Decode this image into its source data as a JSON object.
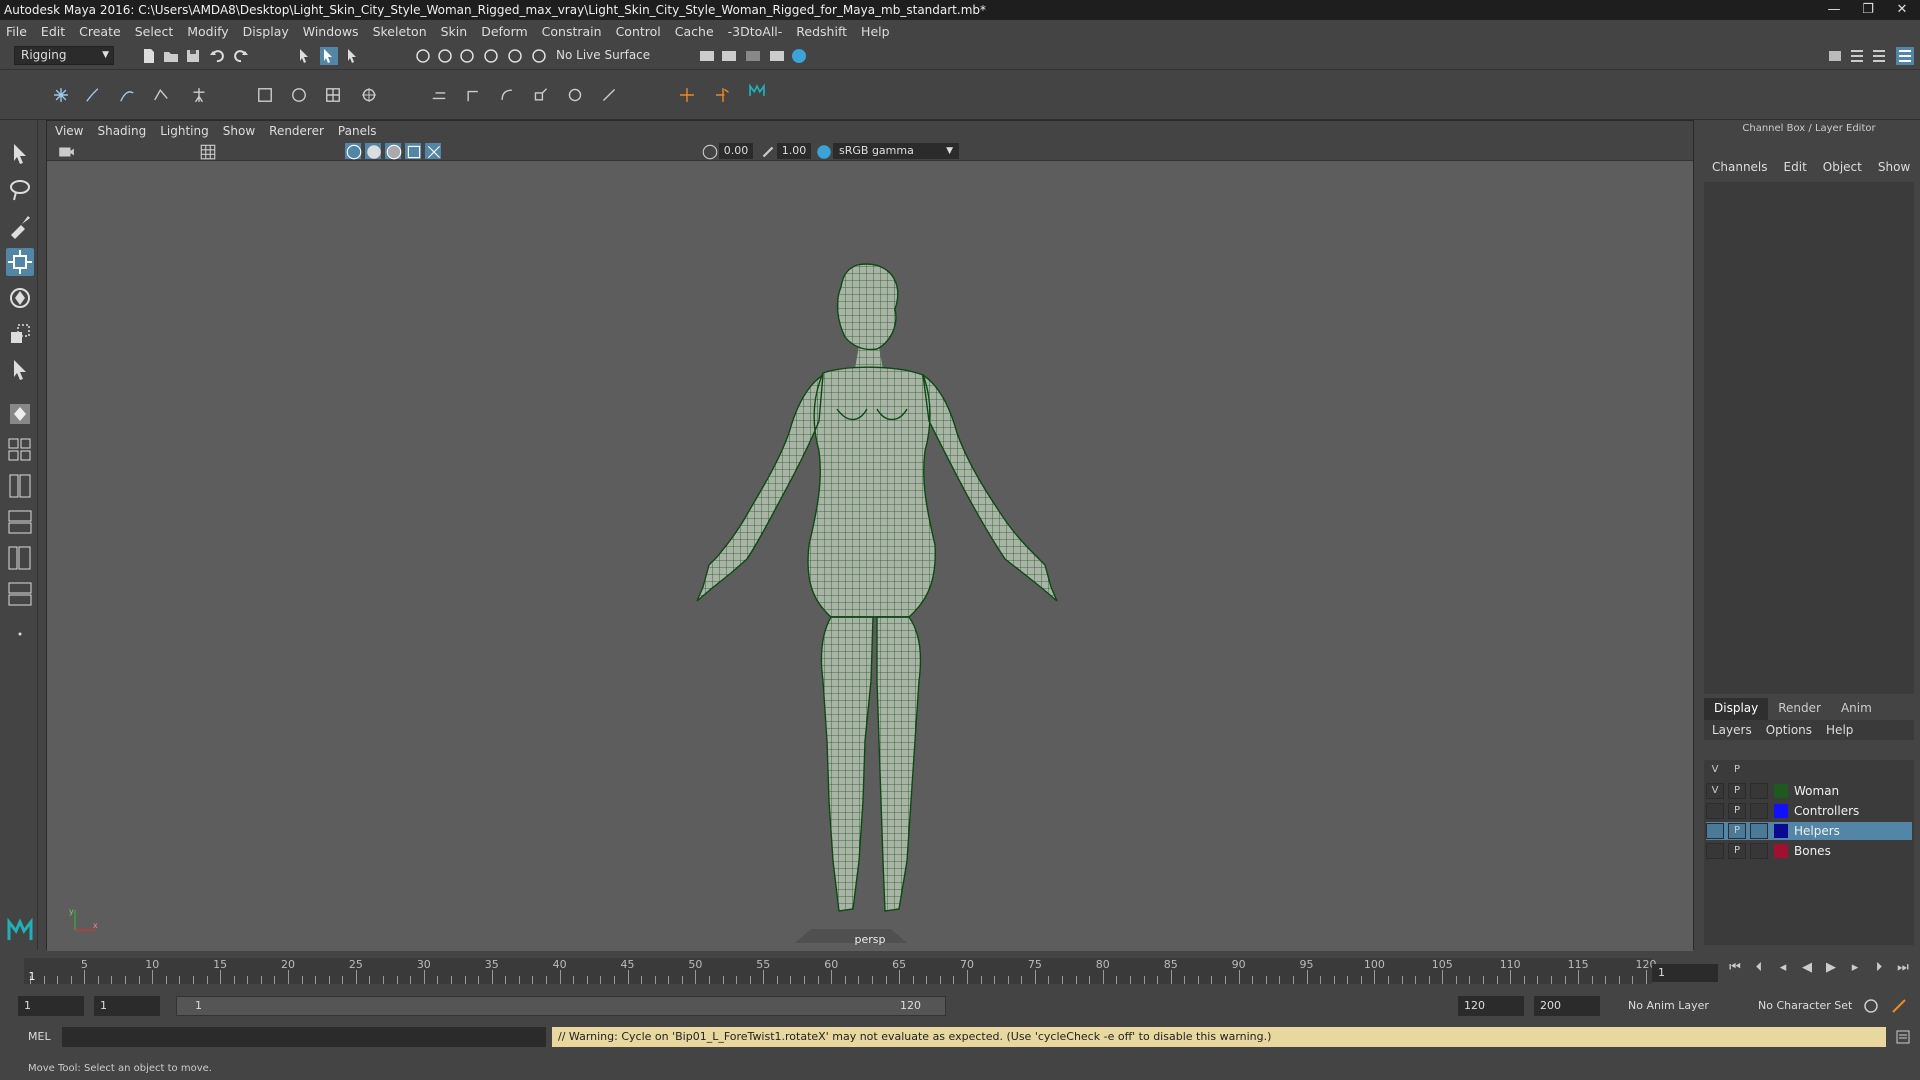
{
  "window": {
    "title": "Autodesk Maya 2016: C:\\Users\\AMDA8\\Desktop\\Light_Skin_City_Style_Woman_Rigged_max_vray\\Light_Skin_City_Style_Woman_Rigged_for_Maya_mb_standart.mb*",
    "min": "—",
    "max": "❐",
    "close": "✕"
  },
  "menubar": [
    "File",
    "Edit",
    "Create",
    "Select",
    "Modify",
    "Display",
    "Windows",
    "Skeleton",
    "Skin",
    "Deform",
    "Constrain",
    "Control",
    "Cache",
    "-3DtoAll-",
    "Redshift",
    "Help"
  ],
  "statusline": {
    "menuset": "Rigging",
    "live_surface": "No Live Surface"
  },
  "panel": {
    "menu": [
      "View",
      "Shading",
      "Lighting",
      "Show",
      "Renderer",
      "Panels"
    ],
    "near_value": "0.00",
    "far_value": "1.00",
    "color_space": "sRGB gamma",
    "camera_label": "persp",
    "axis_x": "x",
    "axis_y": "y"
  },
  "channelbox": {
    "title": "Channel Box / Layer Editor",
    "menu": [
      "Channels",
      "Edit",
      "Object",
      "Show"
    ],
    "layer_tabs": [
      "Display",
      "Render",
      "Anim"
    ],
    "layer_menu": [
      "Layers",
      "Options",
      "Help"
    ],
    "layer_header_v": "V",
    "layer_header_p": "P",
    "layers": [
      {
        "name": "Woman",
        "color": "#1e5a1e",
        "v": "V",
        "p": "P"
      },
      {
        "name": "Controllers",
        "color": "#1010ff",
        "v": "",
        "p": "P"
      },
      {
        "name": "Helpers",
        "color": "#0a0a90",
        "v": "",
        "p": "P"
      },
      {
        "name": "Bones",
        "color": "#a01030",
        "v": "",
        "p": "P"
      }
    ]
  },
  "timeslider": {
    "ticks": [
      "5",
      "10",
      "15",
      "20",
      "25",
      "30",
      "35",
      "40",
      "45",
      "50",
      "55",
      "60",
      "65",
      "70",
      "75",
      "80",
      "85",
      "90",
      "95",
      "100",
      "105",
      "110",
      "115",
      "120"
    ],
    "current_marker": "1",
    "current_frame": "1"
  },
  "range": {
    "start": "1",
    "current": "1",
    "range_start": "1",
    "range_end": "120",
    "end": "120",
    "anim_end": "200",
    "anim_layer": "No Anim Layer",
    "character_set": "No Character Set"
  },
  "cmdline": {
    "mel_label": "MEL",
    "warning": "// Warning: Cycle on 'Bip01_L_ForeTwist1.rotateX' may not evaluate as expected.  (Use 'cycleCheck -e off' to disable this warning.)"
  },
  "helpline": "Move Tool: Select an object to move."
}
